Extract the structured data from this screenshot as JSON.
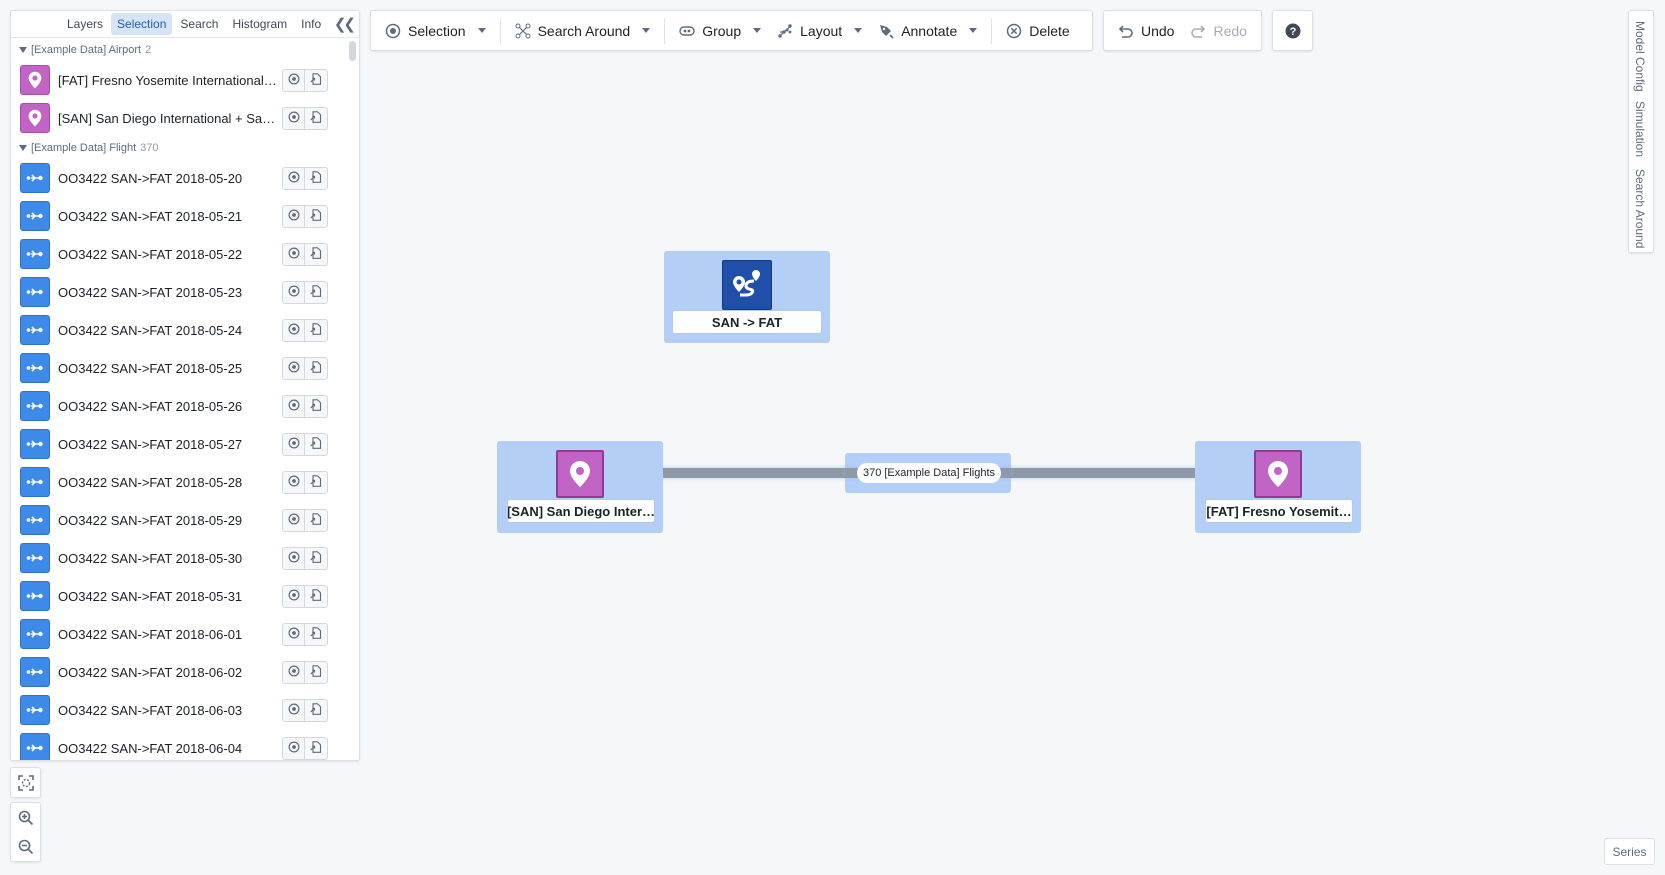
{
  "left_panel": {
    "tabs": [
      {
        "label": "Layers",
        "active": false
      },
      {
        "label": "Selection",
        "active": true
      },
      {
        "label": "Search",
        "active": false
      },
      {
        "label": "Histogram",
        "active": false
      },
      {
        "label": "Info",
        "active": false
      }
    ],
    "collapse_icon": "double-chevron-left",
    "groups": [
      {
        "name": "[Example Data] Airport",
        "count": "2",
        "icon": "map-pin-icon",
        "items": [
          {
            "label": "[FAT] Fresno Yosemite International…"
          },
          {
            "label": "[SAN] San Diego International + San…"
          }
        ]
      },
      {
        "name": "[Example Data] Flight",
        "count": "370",
        "icon": "flight-route-icon",
        "items": [
          {
            "label": "OO3422 SAN->FAT 2018-05-20"
          },
          {
            "label": "OO3422 SAN->FAT 2018-05-21"
          },
          {
            "label": "OO3422 SAN->FAT 2018-05-22"
          },
          {
            "label": "OO3422 SAN->FAT 2018-05-23"
          },
          {
            "label": "OO3422 SAN->FAT 2018-05-24"
          },
          {
            "label": "OO3422 SAN->FAT 2018-05-25"
          },
          {
            "label": "OO3422 SAN->FAT 2018-05-26"
          },
          {
            "label": "OO3422 SAN->FAT 2018-05-27"
          },
          {
            "label": "OO3422 SAN->FAT 2018-05-28"
          },
          {
            "label": "OO3422 SAN->FAT 2018-05-29"
          },
          {
            "label": "OO3422 SAN->FAT 2018-05-30"
          },
          {
            "label": "OO3422 SAN->FAT 2018-05-31"
          },
          {
            "label": "OO3422 SAN->FAT 2018-06-01"
          },
          {
            "label": "OO3422 SAN->FAT 2018-06-02"
          },
          {
            "label": "OO3422 SAN->FAT 2018-06-03"
          },
          {
            "label": "OO3422 SAN->FAT 2018-06-04"
          }
        ]
      }
    ]
  },
  "toolbar": {
    "selection": "Selection",
    "search_around": "Search Around",
    "group": "Group",
    "layout": "Layout",
    "annotate": "Annotate",
    "delete": "Delete",
    "undo": "Undo",
    "redo": "Redo",
    "help_icon": "question-icon"
  },
  "right_tabs": [
    "Model Config",
    "Simulation",
    "Search Around"
  ],
  "series_label": "Series",
  "graph": {
    "route_node": {
      "label": "SAN -> FAT"
    },
    "san_node": {
      "label": "[SAN] San Diego Inter…"
    },
    "fat_node": {
      "label": "[FAT] Fresno Yosemit…"
    },
    "edge": {
      "label": "370 [Example Data] Flights"
    }
  },
  "colors": {
    "airport": "#c264c6",
    "flight": "#3e8ae8",
    "route": "#1f4fa8",
    "selection_highlight": "#b3cff5",
    "edge": "#8f99a8"
  }
}
